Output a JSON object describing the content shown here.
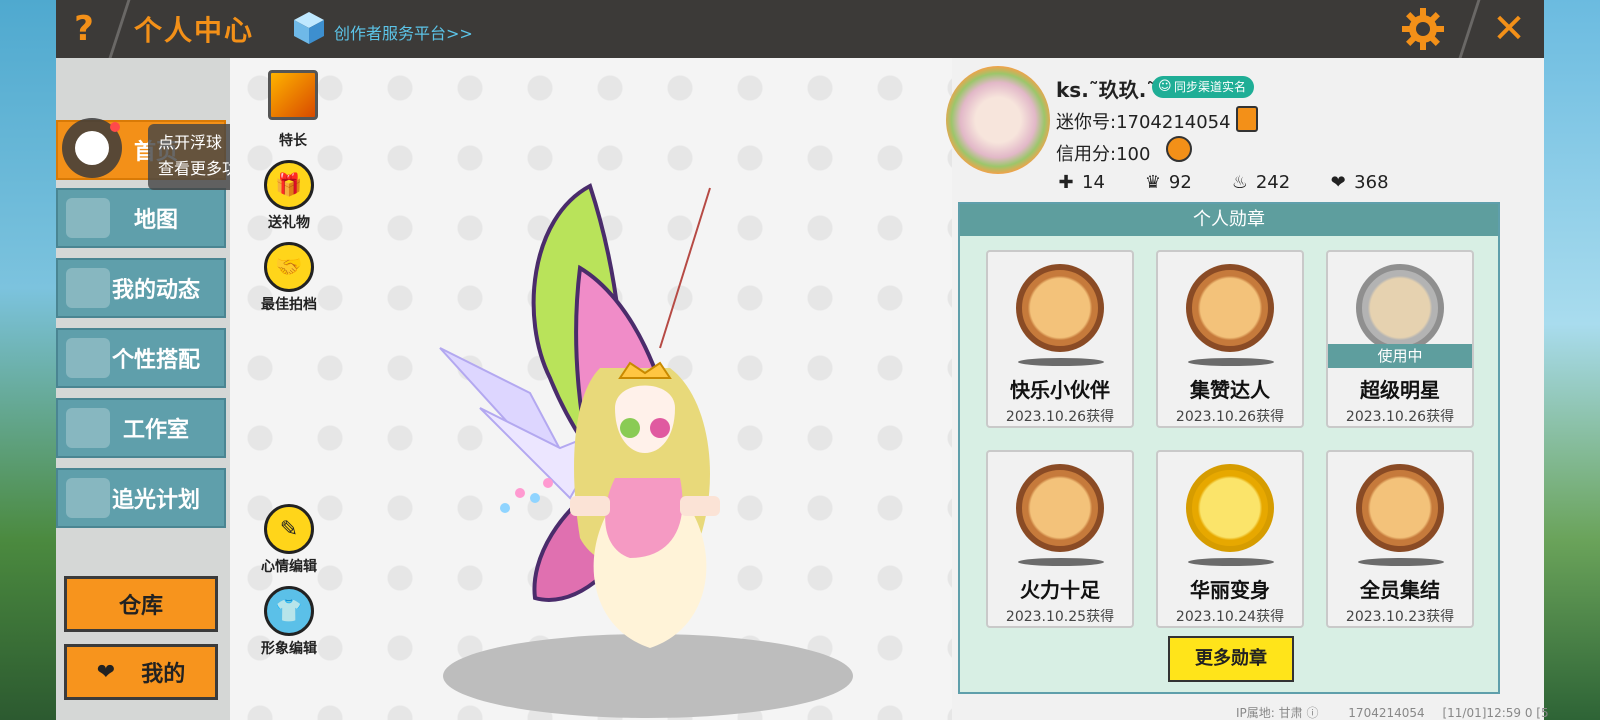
{
  "header": {
    "title": "个人中心",
    "creator_link": "创作者服务平台>>"
  },
  "tooltip": {
    "line1": "点开浮球",
    "line2": "查看更多功能哦"
  },
  "menu": {
    "items": [
      {
        "label": "首页"
      },
      {
        "label": "地图"
      },
      {
        "label": "我的动态"
      },
      {
        "label": "个性搭配"
      },
      {
        "label": "工作室"
      },
      {
        "label": "追光计划"
      }
    ],
    "warehouse": "仓库",
    "mine": "我的"
  },
  "tools": {
    "specialty": "特长",
    "gift": "送礼物",
    "partner": "最佳拍档",
    "mood_edit": "心情编辑",
    "image_edit": "形象编辑"
  },
  "profile": {
    "username": "ks.˜玖玖.˜",
    "realname_badge": "同步渠道实名",
    "mini_id": "迷你号:1704214054",
    "credit": "信用分:100",
    "stats": [
      "14",
      "92",
      "242",
      "368"
    ]
  },
  "medals": {
    "title": "个人勋章",
    "in_use_label": "使用中",
    "items": [
      {
        "name": "快乐小伙伴",
        "date": "2023.10.26获得"
      },
      {
        "name": "集赞达人",
        "date": "2023.10.26获得"
      },
      {
        "name": "超级明星",
        "date": "2023.10.26获得"
      },
      {
        "name": "火力十足",
        "date": "2023.10.25获得"
      },
      {
        "name": "华丽变身",
        "date": "2023.10.24获得"
      },
      {
        "name": "全员集结",
        "date": "2023.10.23获得"
      }
    ],
    "more_button": "更多勋章"
  },
  "footer": {
    "ip": "IP属地: 甘肃",
    "id": "1704214054",
    "time": "[11/01]12:59 0 [5"
  },
  "colors": {
    "accent": "#f39018",
    "teal": "#5f9fab",
    "panel": "#d8efe4"
  }
}
